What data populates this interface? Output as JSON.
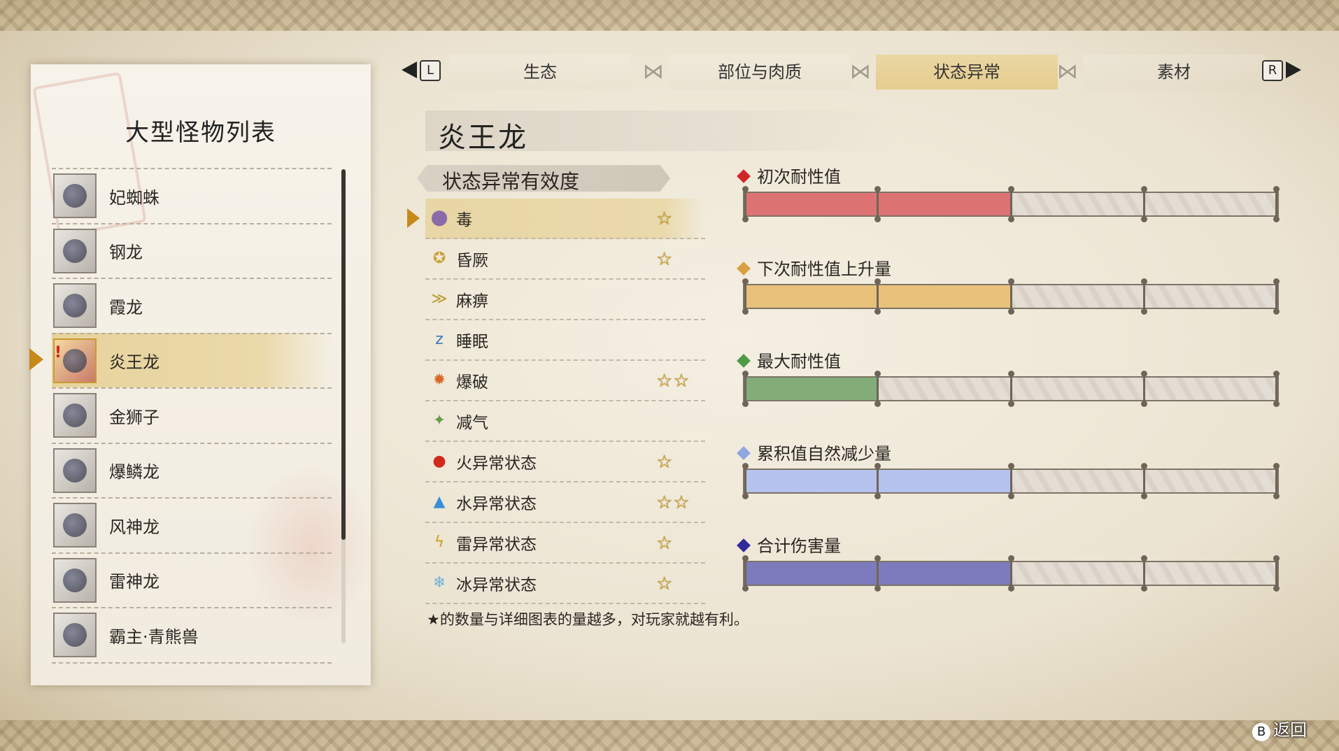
{
  "tabs": [
    {
      "label": "生态",
      "active": false
    },
    {
      "label": "部位与肉质",
      "active": false
    },
    {
      "label": "状态异常",
      "active": true
    },
    {
      "label": "素材",
      "active": false
    }
  ],
  "nav": {
    "left_key": "L",
    "right_key": "R"
  },
  "list_panel": {
    "title": "大型怪物列表",
    "monsters": [
      {
        "name": "妃蜘蛛",
        "selected": false
      },
      {
        "name": "钢龙",
        "selected": false
      },
      {
        "name": "霞龙",
        "selected": false
      },
      {
        "name": "炎王龙",
        "selected": true,
        "alert": "!"
      },
      {
        "name": "金狮子",
        "selected": false
      },
      {
        "name": "爆鳞龙",
        "selected": false
      },
      {
        "name": "风神龙",
        "selected": false
      },
      {
        "name": "雷神龙",
        "selected": false
      },
      {
        "name": "霸主·青熊兽",
        "selected": false
      }
    ]
  },
  "monster_name": "炎王龙",
  "effectiveness": {
    "header": "状态异常有效度",
    "rows": [
      {
        "label": "毒",
        "stars": "☆",
        "icon": "poison-icon",
        "glyph": "⬤",
        "color": "#8a6aa8",
        "selected": true
      },
      {
        "label": "昏厥",
        "stars": "☆",
        "icon": "stun-icon",
        "glyph": "✪",
        "color": "#c9a23a",
        "selected": false
      },
      {
        "label": "麻痹",
        "stars": "",
        "icon": "paralysis-icon",
        "glyph": "≫",
        "color": "#b59b2a",
        "selected": false
      },
      {
        "label": "睡眠",
        "stars": "",
        "icon": "sleep-icon",
        "glyph": "z",
        "color": "#3f78b8",
        "selected": false
      },
      {
        "label": "爆破",
        "stars": "☆☆",
        "icon": "blast-icon",
        "glyph": "✹",
        "color": "#d8682a",
        "selected": false
      },
      {
        "label": "减气",
        "stars": "",
        "icon": "exhaust-icon",
        "glyph": "✦",
        "color": "#6a9a4a",
        "selected": false
      },
      {
        "label": "火异常状态",
        "stars": "☆",
        "icon": "fire-icon",
        "glyph": "●",
        "color": "#d02a1a",
        "selected": false
      },
      {
        "label": "水异常状态",
        "stars": "☆☆",
        "icon": "water-icon",
        "glyph": "💧",
        "color": "#3a8fd8",
        "selected": false
      },
      {
        "label": "雷异常状态",
        "stars": "☆",
        "icon": "thunder-icon",
        "glyph": "ϟ",
        "color": "#c9a21a",
        "selected": false
      },
      {
        "label": "冰异常状态",
        "stars": "☆",
        "icon": "ice-icon",
        "glyph": "❄",
        "color": "#6ab0d8",
        "selected": false
      }
    ],
    "footnote": "★的数量与详细图表的量越多，对玩家就越有利。"
  },
  "stats": [
    {
      "label": "初次耐性值",
      "color": "#d02828",
      "fill_color": "#dd7272",
      "fill_segments": 2
    },
    {
      "label": "下次耐性值上升量",
      "color": "#d8a040",
      "fill_color": "#e8c27a",
      "fill_segments": 2
    },
    {
      "label": "最大耐性值",
      "color": "#4f9a47",
      "fill_color": "#82ad78",
      "fill_segments": 1
    },
    {
      "label": "累积值自然减少量",
      "color": "#8fa6e0",
      "fill_color": "#b5c3ee",
      "fill_segments": 2
    },
    {
      "label": "合计伤害量",
      "color": "#302a9a",
      "fill_color": "#7c7bbd",
      "fill_segments": 2
    }
  ],
  "bar_segments_total": 4,
  "back": {
    "key": "B",
    "label": "返回"
  }
}
